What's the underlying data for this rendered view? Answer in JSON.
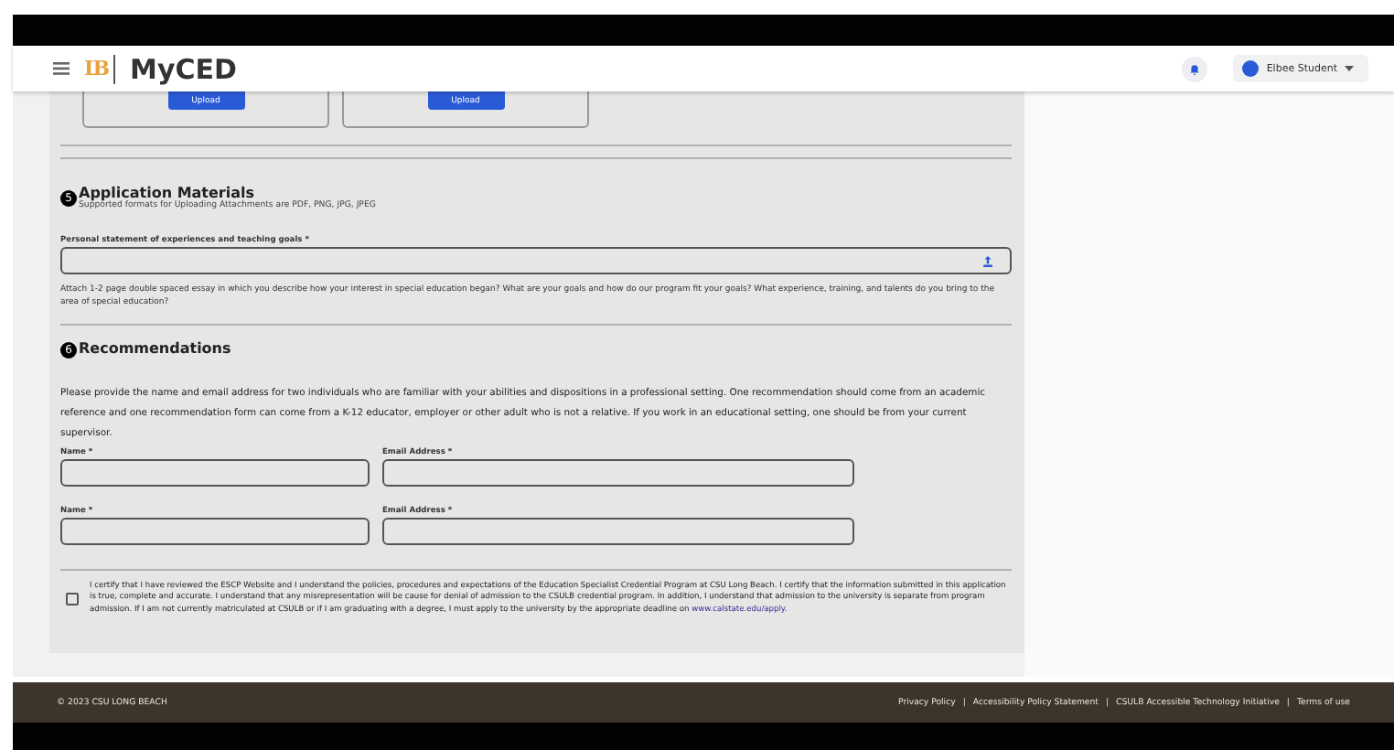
{
  "header": {
    "logo_mark": "LB",
    "app_name": "MyCED",
    "user": {
      "name": "Elbee Student"
    }
  },
  "uploads": [
    {
      "button": "Upload"
    },
    {
      "button": "Upload"
    }
  ],
  "sections": [
    {
      "number": "5",
      "title": "Application Materials",
      "subtitle": "Supported formats for Uploading Attachments are PDF, PNG, JPG, JPEG",
      "field_label": "Personal statement of experiences and teaching goals *",
      "help": "Attach 1-2 page double spaced essay in which you describe how your interest in special education began? What are your goals and how do our program fit your goals? What experience, training, and talents do you bring to the area of special education?"
    },
    {
      "number": "6",
      "title": "Recommendations",
      "paragraph": "Please provide the name and email address for two individuals who are familiar with your abilities and dispositions in a professional setting. One recommendation should come from an academic reference and one recommendation form can come from a K-12 educator, employer or other adult who is not a relative. If you work in an educational setting, one should be from your current supervisor.",
      "recommenders": [
        {
          "name_label": "Name *",
          "email_label": "Email Address *"
        },
        {
          "name_label": "Name *",
          "email_label": "Email Address *"
        }
      ]
    }
  ],
  "certification": {
    "checked": false,
    "text": "I certify that I have reviewed the ESCP Website and I understand the policies, procedures and expectations of the Education Specialist Credential Program at CSU Long Beach. I certify that the information submitted in this application is true, complete and accurate. I understand that any misrepresentation will be cause for denial of admission to the CSULB credential program. In addition, I understand that admission to the university is separate from program admission. If I am not currently matriculated at CSULB or if I am graduating with a degree, I must apply to the university by the appropriate deadline on",
    "link": "www.calstate.edu/apply."
  },
  "footer": {
    "copyright": "© 2023 CSU LONG BEACH",
    "links": [
      "Privacy Policy",
      "Accessibility Policy Statement",
      "CSULB Accessible Technology Initiative",
      "Terms of use"
    ],
    "separator": "|"
  }
}
